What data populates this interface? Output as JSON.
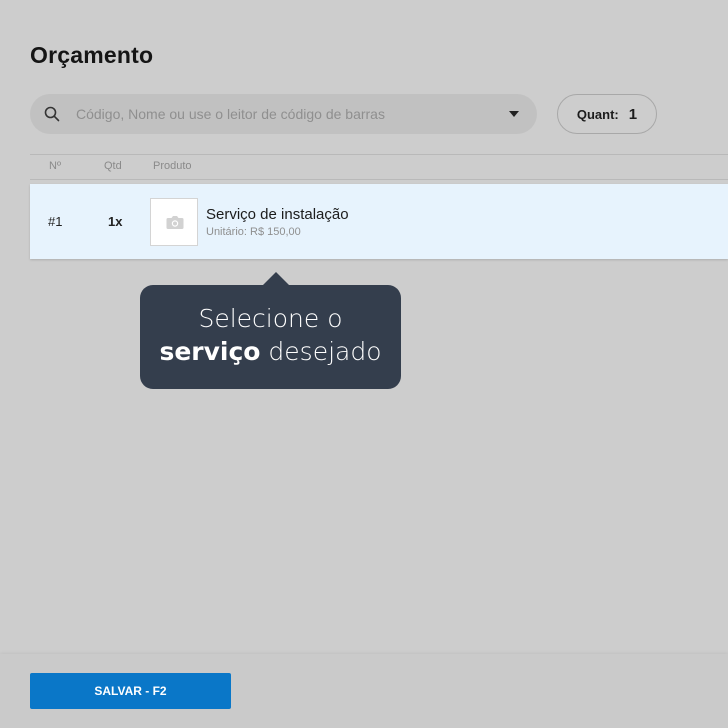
{
  "page": {
    "title": "Orçamento"
  },
  "search": {
    "placeholder": "Código, Nome ou use o leitor de código de barras",
    "value": ""
  },
  "quantity": {
    "label": "Quant:",
    "value": "1"
  },
  "table": {
    "columns": [
      "Nº",
      "Qtd",
      "Produto"
    ],
    "rows": [
      {
        "number": "#1",
        "qty": "1x",
        "name": "Serviço de instalação",
        "unit_price": "Unitário: R$ 150,00"
      }
    ]
  },
  "tooltip": {
    "line1": "Selecione o",
    "line2_bold": "serviço",
    "line2_rest": " desejado"
  },
  "footer": {
    "save_label": "SALVAR - F2"
  },
  "colors": {
    "background": "#cdcdcd",
    "selected_row": "#e7f3fd",
    "tooltip": "#343e4d",
    "primary_button": "#0a77c8"
  },
  "icons": {
    "search": "search-icon",
    "dropdown": "chevron-down-icon",
    "thumbnail": "camera-icon"
  }
}
